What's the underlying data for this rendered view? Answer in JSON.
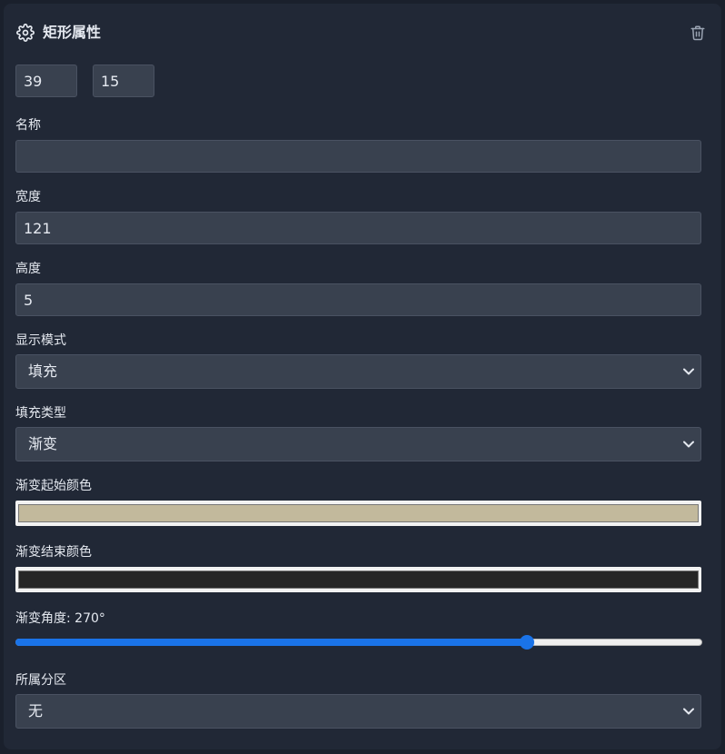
{
  "panel": {
    "title": "矩形属性",
    "header_icon": "gear-icon",
    "delete_icon": "trash-icon"
  },
  "position": {
    "x": "39",
    "y": "15"
  },
  "fields": {
    "name_label": "名称",
    "name_value": "",
    "width_label": "宽度",
    "width_value": "121",
    "height_label": "高度",
    "height_value": "5"
  },
  "display_mode": {
    "label": "显示模式",
    "selected": "填充"
  },
  "fill_type": {
    "label": "填充类型",
    "selected": "渐变"
  },
  "gradient": {
    "start_label": "渐变起始颜色",
    "start_color": "#c2b99c",
    "end_label": "渐变结束颜色",
    "end_color": "#262626",
    "angle_label": "渐变角度: 270°",
    "angle_value": 270,
    "angle_max": 360
  },
  "partition": {
    "label": "所属分区",
    "selected": "无"
  },
  "colors": {
    "accent": "#1a73e8",
    "panel_bg": "#212836",
    "input_bg": "#39414f",
    "text": "#e5e9f0"
  }
}
